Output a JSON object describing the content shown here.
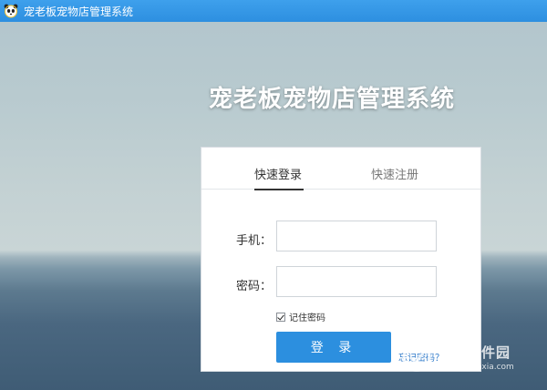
{
  "window": {
    "title": "宠老板宠物店管理系统",
    "app_icon": "panda-icon"
  },
  "hero": {
    "title": "宠老板宠物店管理系统"
  },
  "login": {
    "tabs": [
      {
        "label": "快速登录",
        "active": true
      },
      {
        "label": "快速注册",
        "active": false
      }
    ],
    "phone_label": "手机：",
    "phone_value": "",
    "password_label": "密码：",
    "password_value": "",
    "remember_label": "记住密码",
    "remember_checked": true,
    "submit_label": "登 录",
    "forgot_label": "忘记密码？"
  },
  "watermark": {
    "main": "当下软件园",
    "sub": "www.downxia.com"
  },
  "colors": {
    "titlebar": "#2d8fe0",
    "accent": "#2c8fdf",
    "link": "#2c78c9"
  }
}
